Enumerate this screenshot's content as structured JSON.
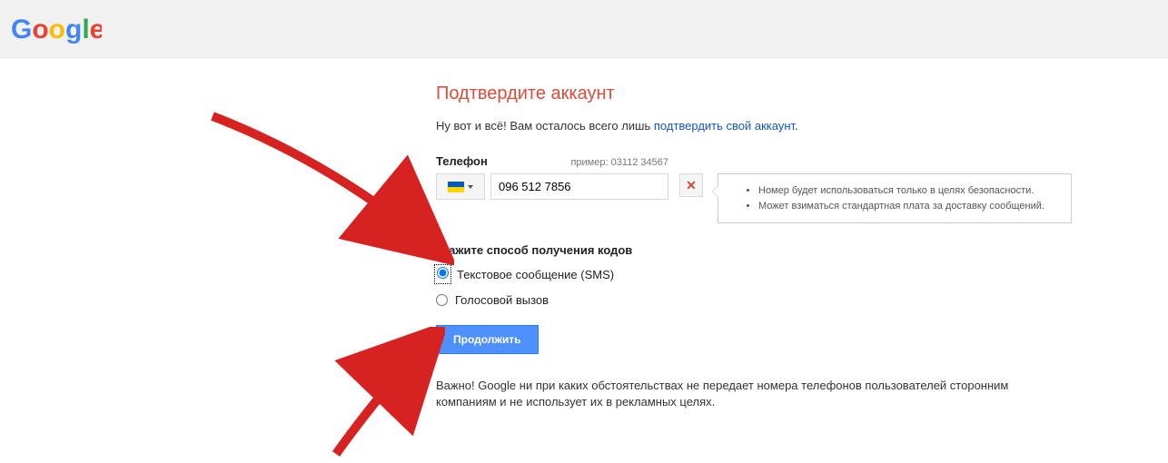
{
  "header": {
    "logo_alt": "Google"
  },
  "main": {
    "title": "Подтвердите аккаунт",
    "intro_prefix": "Ну вот и всё! Вам осталось всего лишь ",
    "intro_link": "подтвердить свой аккаунт",
    "intro_suffix": ".",
    "phone": {
      "label": "Телефон",
      "example": "пример: 03112 34567",
      "value": "096 512 7856",
      "country": "Ukraine"
    },
    "tooltip": {
      "line1": "Номер будет использоваться только в целях безопасности.",
      "line2": "Может взиматься стандартная плата за доставку сообщений."
    },
    "method_label": "Укажите способ получения кодов",
    "options": {
      "sms": "Текстовое сообщение (SMS)",
      "voice": "Голосовой вызов"
    },
    "submit": "Продолжить",
    "disclaimer": "Важно! Google ни при каких обстоятельствах не передает номера телефонов пользователей сторонним компаниям и не использует их в рекламных целях."
  }
}
